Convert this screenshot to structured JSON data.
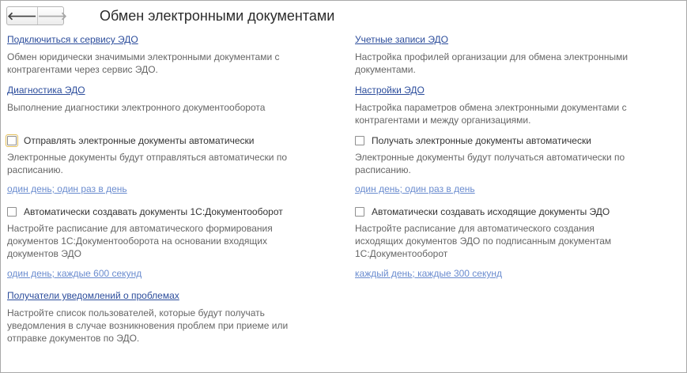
{
  "header": {
    "title": "Обмен электронными документами",
    "back_glyph": "🡐",
    "forward_glyph": "🡒"
  },
  "left": {
    "connect": {
      "link": "Подключиться к сервису ЭДО",
      "desc": "Обмен юридически значимыми электронными документами с\nконтрагентами через сервис ЭДО."
    },
    "diagnostics": {
      "link": "Диагностика ЭДО",
      "desc": "Выполнение диагностики электронного документооборота"
    },
    "auto_send": {
      "label": "Отправлять электронные документы автоматически",
      "checked": false,
      "desc": "Электронные документы будут отправляться автоматически по\nрасписанию.",
      "schedule": "один день; один раз в день"
    },
    "auto_create_1c": {
      "label": "Автоматически создавать документы 1С:Документооборот",
      "checked": false,
      "desc": "Настройте расписание для автоматического формирования\nдокументов 1С:Документооборота на основании входящих\nдокументов ЭДО",
      "schedule": "один день; каждые 600 секунд"
    },
    "notifications": {
      "link": "Получатели уведомлений о проблемах",
      "desc": "Настройте список пользователей, которые будут получать\nуведомления в случае возникновения проблем при приеме или\nотправке документов по ЭДО."
    }
  },
  "right": {
    "accounts": {
      "link": "Учетные записи ЭДО",
      "desc": "Настройка профилей организации для обмена электронными\nдокументами."
    },
    "settings": {
      "link": "Настройки ЭДО",
      "desc": "Настройка параметров обмена электронными документами с\nконтрагентами и между организациями."
    },
    "auto_receive": {
      "label": "Получать электронные документы автоматически",
      "checked": false,
      "desc": "Электронные документы будут получаться автоматически по\nрасписанию.",
      "schedule": "один день; один раз в день"
    },
    "auto_create_outgoing": {
      "label": "Автоматически создавать исходящие документы ЭДО",
      "checked": false,
      "desc": "Настройте расписание для автоматического создания\nисходящих документов ЭДО по подписанным документам\n1С:Документооборот",
      "schedule": "каждый день; каждые 300 секунд"
    }
  }
}
